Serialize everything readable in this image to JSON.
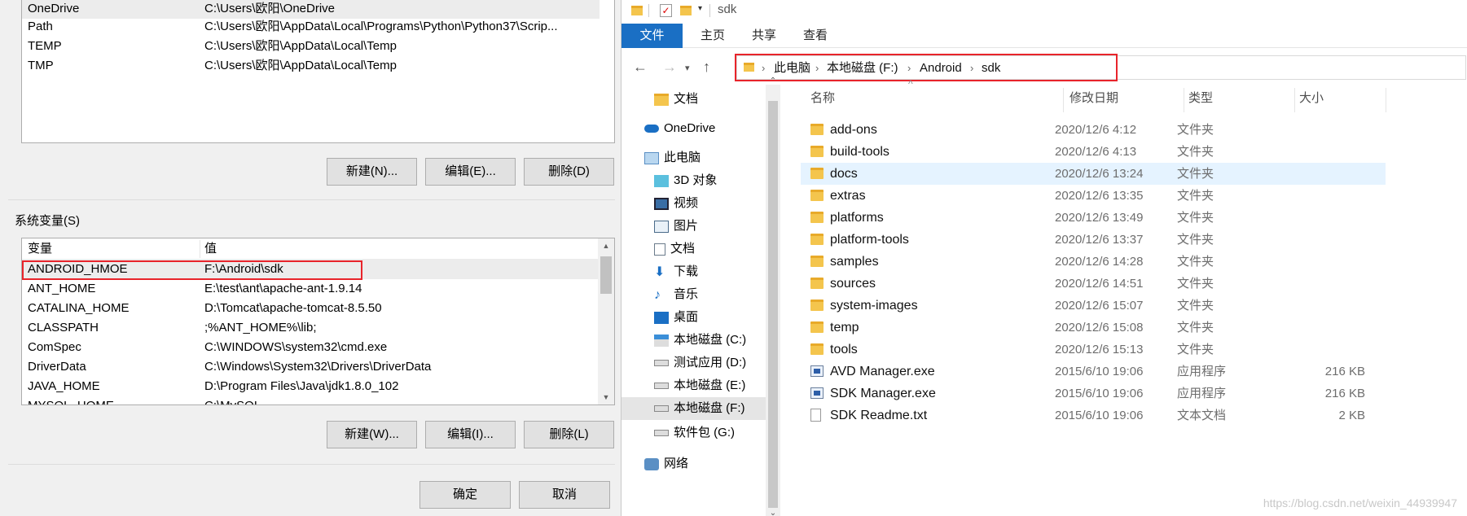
{
  "user_vars": {
    "rows": [
      {
        "name": "OneDrive",
        "value": "C:\\Users\\欧阳\\OneDrive"
      },
      {
        "name": "Path",
        "value": "C:\\Users\\欧阳\\AppData\\Local\\Programs\\Python\\Python37\\Scrip..."
      },
      {
        "name": "TEMP",
        "value": "C:\\Users\\欧阳\\AppData\\Local\\Temp"
      },
      {
        "name": "TMP",
        "value": "C:\\Users\\欧阳\\AppData\\Local\\Temp"
      }
    ],
    "new_label": "新建(N)...",
    "edit_label": "编辑(E)...",
    "delete_label": "删除(D)"
  },
  "system_vars": {
    "group_label": "系统变量(S)",
    "col_name": "变量",
    "col_value": "值",
    "rows": [
      {
        "name": "ANDROID_HMOE",
        "value": "F:\\Android\\sdk"
      },
      {
        "name": "ANT_HOME",
        "value": "E:\\test\\ant\\apache-ant-1.9.14"
      },
      {
        "name": "CATALINA_HOME",
        "value": "D:\\Tomcat\\apache-tomcat-8.5.50"
      },
      {
        "name": "CLASSPATH",
        "value": ";%ANT_HOME%\\lib;"
      },
      {
        "name": "ComSpec",
        "value": "C:\\WINDOWS\\system32\\cmd.exe"
      },
      {
        "name": "DriverData",
        "value": "C:\\Windows\\System32\\Drivers\\DriverData"
      },
      {
        "name": "JAVA_HOME",
        "value": "D:\\Program Files\\Java\\jdk1.8.0_102"
      },
      {
        "name": "MYSQL_HOME",
        "value": "C:\\MySQL"
      }
    ],
    "new_label": "新建(W)...",
    "edit_label": "编辑(I)...",
    "delete_label": "删除(L)"
  },
  "dialog": {
    "ok_label": "确定",
    "cancel_label": "取消"
  },
  "explorer": {
    "title": "sdk",
    "ribbon_tabs": [
      "文件",
      "主页",
      "共享",
      "查看"
    ],
    "breadcrumb": [
      "此电脑",
      "本地磁盘 (F:)",
      "Android",
      "sdk"
    ],
    "nav_items": [
      {
        "label": "文档",
        "icon": "folder-icon"
      },
      {
        "label": "OneDrive",
        "icon": "cloud-icon"
      },
      {
        "label": "此电脑",
        "icon": "computer-icon"
      },
      {
        "label": "3D 对象",
        "icon": "cube-icon"
      },
      {
        "label": "视频",
        "icon": "video-icon"
      },
      {
        "label": "图片",
        "icon": "picture-icon"
      },
      {
        "label": "文档",
        "icon": "document-icon"
      },
      {
        "label": "下载",
        "icon": "download-icon"
      },
      {
        "label": "音乐",
        "icon": "music-icon"
      },
      {
        "label": "桌面",
        "icon": "desktop-icon"
      },
      {
        "label": "本地磁盘 (C:)",
        "icon": "windows-drive-icon"
      },
      {
        "label": "测试应用 (D:)",
        "icon": "drive-icon"
      },
      {
        "label": "本地磁盘 (E:)",
        "icon": "drive-icon"
      },
      {
        "label": "本地磁盘 (F:)",
        "icon": "drive-icon"
      },
      {
        "label": "软件包 (G:)",
        "icon": "drive-icon"
      },
      {
        "label": "网络",
        "icon": "network-icon"
      }
    ],
    "columns": {
      "name": "名称",
      "date": "修改日期",
      "type": "类型",
      "size": "大小"
    },
    "files": [
      {
        "name": "add-ons",
        "date": "2020/12/6 4:12",
        "type": "文件夹",
        "size": "",
        "kind": "folder"
      },
      {
        "name": "build-tools",
        "date": "2020/12/6 4:13",
        "type": "文件夹",
        "size": "",
        "kind": "folder"
      },
      {
        "name": "docs",
        "date": "2020/12/6 13:24",
        "type": "文件夹",
        "size": "",
        "kind": "folder"
      },
      {
        "name": "extras",
        "date": "2020/12/6 13:35",
        "type": "文件夹",
        "size": "",
        "kind": "folder"
      },
      {
        "name": "platforms",
        "date": "2020/12/6 13:49",
        "type": "文件夹",
        "size": "",
        "kind": "folder"
      },
      {
        "name": "platform-tools",
        "date": "2020/12/6 13:37",
        "type": "文件夹",
        "size": "",
        "kind": "folder"
      },
      {
        "name": "samples",
        "date": "2020/12/6 14:28",
        "type": "文件夹",
        "size": "",
        "kind": "folder"
      },
      {
        "name": "sources",
        "date": "2020/12/6 14:51",
        "type": "文件夹",
        "size": "",
        "kind": "folder"
      },
      {
        "name": "system-images",
        "date": "2020/12/6 15:07",
        "type": "文件夹",
        "size": "",
        "kind": "folder"
      },
      {
        "name": "temp",
        "date": "2020/12/6 15:08",
        "type": "文件夹",
        "size": "",
        "kind": "folder"
      },
      {
        "name": "tools",
        "date": "2020/12/6 15:13",
        "type": "文件夹",
        "size": "",
        "kind": "folder"
      },
      {
        "name": "AVD Manager.exe",
        "date": "2015/6/10 19:06",
        "type": "应用程序",
        "size": "216 KB",
        "kind": "exe"
      },
      {
        "name": "SDK Manager.exe",
        "date": "2015/6/10 19:06",
        "type": "应用程序",
        "size": "216 KB",
        "kind": "exe"
      },
      {
        "name": "SDK Readme.txt",
        "date": "2015/6/10 19:06",
        "type": "文本文档",
        "size": "2 KB",
        "kind": "txt"
      }
    ],
    "watermark": "https://blog.csdn.net/weixin_44939947"
  },
  "colors": {
    "highlight_red": "#e8242b",
    "ribbon_file_tab": "#1a6fc4",
    "selected_row": "#e5f3ff"
  }
}
